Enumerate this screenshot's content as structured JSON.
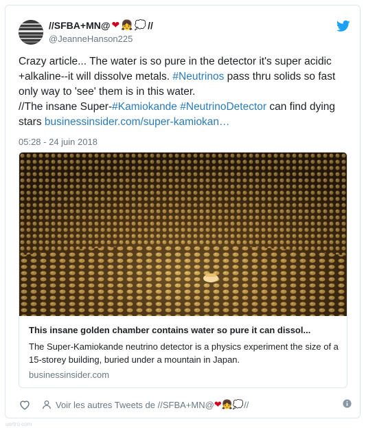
{
  "author": {
    "display_name": "//SFBA+MN@",
    "name_emojis": [
      "❤",
      "👧",
      "💭"
    ],
    "name_suffix": "//",
    "handle": "@JeanneHanson225"
  },
  "tweet": {
    "line1": "Crazy article... The water is so pure in the detector it's super acidic +alkaline--it will dissolve metals. ",
    "hashtag_neutrinos": "#Neutrinos",
    "line1_end": " pass thru solids so fast only way to 'see' them is in this water.",
    "line2_start": "//The insane Super-",
    "hashtag_kamiokande": "#Kamiokande",
    "hashtag_detector": "#NeutrinoDetector",
    "line2_end": " can find dying stars ",
    "link": "businessinsider.com/super-kamiokan…",
    "timestamp": "05:28 - 24 juin 2018"
  },
  "preview": {
    "title": "This insane golden chamber contains water so pure it can dissol...",
    "description": "The Super-Kamiokande neutrino detector is a physics experiment the size of a 15-storey building, buried under a mountain in Japan.",
    "domain": "businessinsider.com"
  },
  "footer": {
    "more_tweets_label": "Voir les autres Tweets de //SFBA+MN@",
    "more_suffix": "//",
    "icons": [
      "heart-icon",
      "person-icon",
      "info-icon"
    ]
  },
  "bottom_strip_text": "uertro com",
  "colors": {
    "link": "#2b7bb9",
    "muted": "#697882",
    "border": "#e1e8ed",
    "twitter_blue": "#1da1f2",
    "heart_red": "#d0021b"
  }
}
